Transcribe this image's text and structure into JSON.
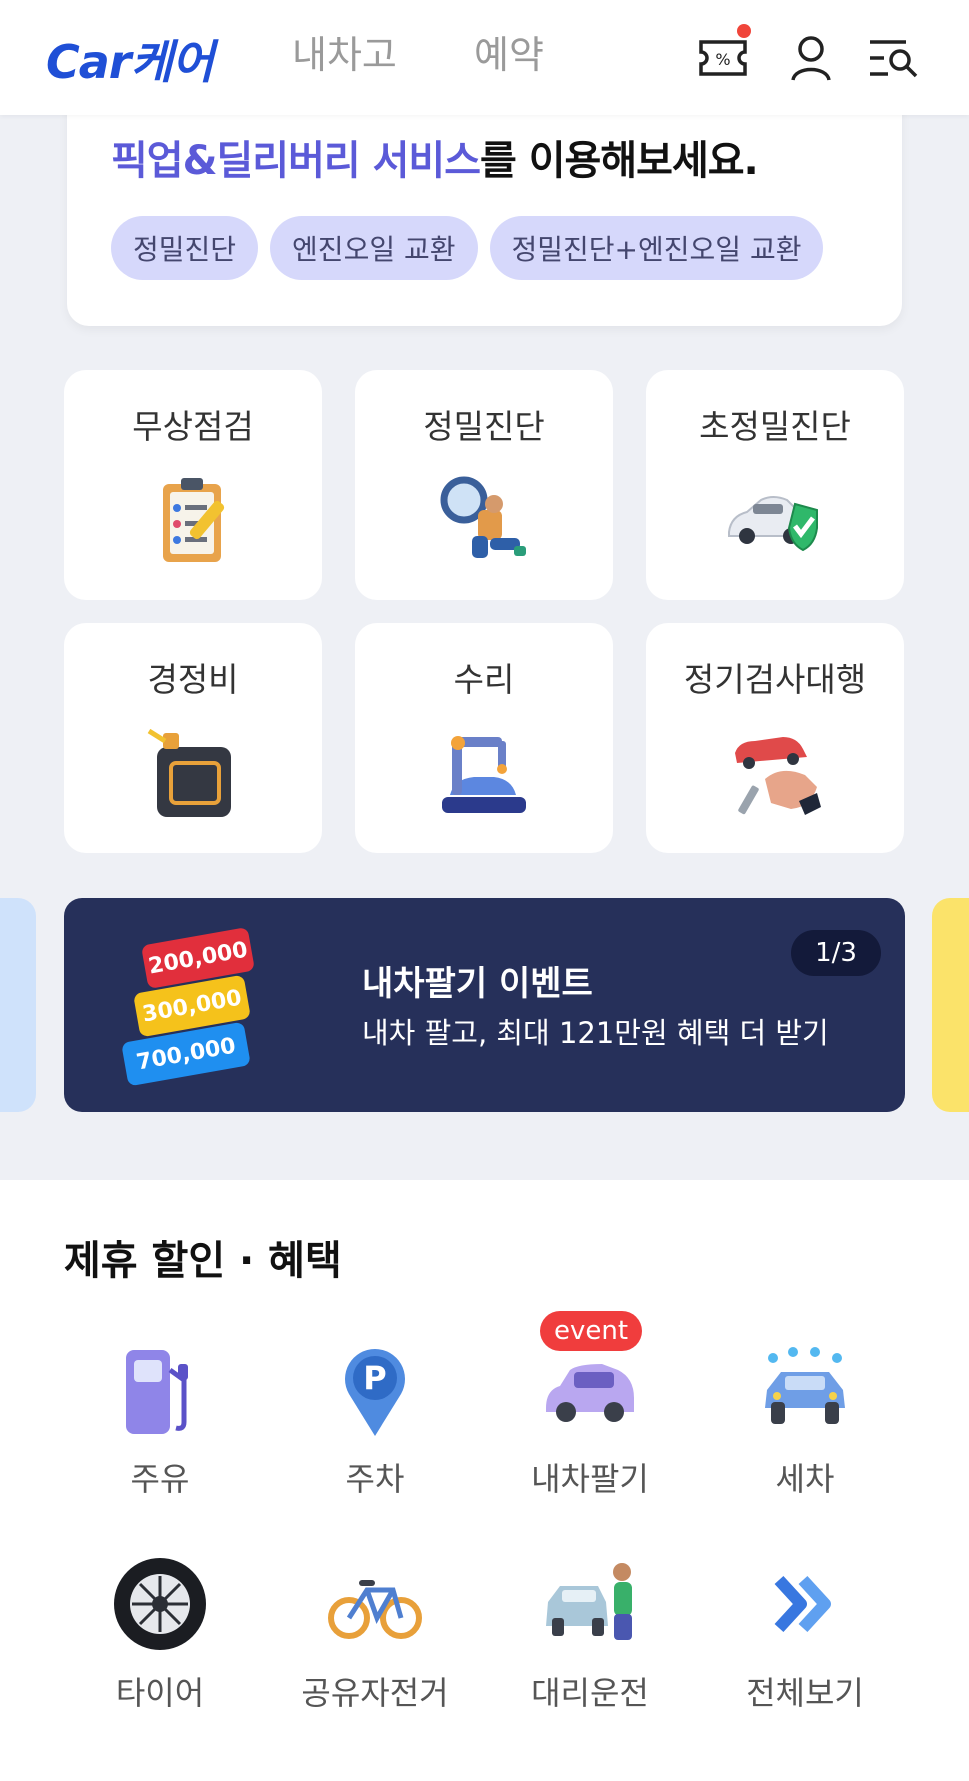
{
  "header": {
    "logo": "Car케어",
    "nav": [
      "내차고",
      "예약"
    ]
  },
  "pickup": {
    "title_highlight": "픽업&딜리버리 서비스",
    "title_rest": "를 이용해보세요.",
    "chips": [
      "정밀진단",
      "엔진오일 교환",
      "정밀진단+엔진오일 교환"
    ]
  },
  "services": [
    {
      "label": "무상점검",
      "icon": "clipboard-checklist-icon"
    },
    {
      "label": "정밀진단",
      "icon": "magnifier-mechanic-icon"
    },
    {
      "label": "초정밀진단",
      "icon": "car-shield-icon"
    },
    {
      "label": "경정비",
      "icon": "oil-can-icon"
    },
    {
      "label": "수리",
      "icon": "robot-arm-icon"
    },
    {
      "label": "정기검사대행",
      "icon": "hand-car-icon"
    }
  ],
  "banner": {
    "title": "내차팔기 이벤트",
    "subtitle": "내차 팔고, 최대 121만원 혜택 더 받기",
    "pager": "1/3",
    "tags": [
      "200,000",
      "300,000",
      "700,000"
    ]
  },
  "partners": {
    "title": "제휴 할인 · 혜택",
    "event_badge": "event",
    "items": [
      {
        "label": "주유",
        "icon": "gas-pump-icon"
      },
      {
        "label": "주차",
        "icon": "parking-pin-icon"
      },
      {
        "label": "내차팔기",
        "icon": "purple-car-icon"
      },
      {
        "label": "세차",
        "icon": "car-wash-icon"
      },
      {
        "label": "타이어",
        "icon": "tire-icon"
      },
      {
        "label": "공유자전거",
        "icon": "bicycle-icon"
      },
      {
        "label": "대리운전",
        "icon": "chauffeur-icon"
      },
      {
        "label": "전체보기",
        "icon": "double-chevron-icon"
      }
    ]
  },
  "colors": {
    "brand": "#1f4fd6",
    "highlight": "#5b5ad8",
    "chip_bg": "#d6d8fb",
    "banner_bg": "#26305a",
    "badge_red": "#f03d3d"
  }
}
